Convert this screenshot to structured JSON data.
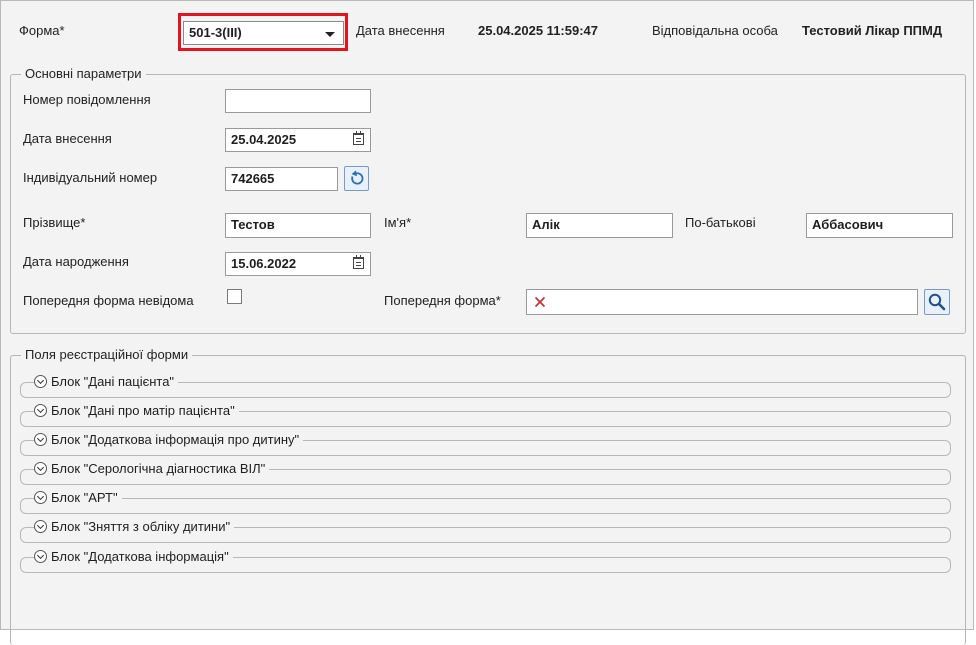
{
  "header": {
    "form_label": "Форма*",
    "form_value": "501-3(III)",
    "entry_date_label": "Дата внесення",
    "entry_date_value": "25.04.2025 11:59:47",
    "responsible_label": "Відповідальна особа",
    "responsible_value": "Тестовий Лікар ППМД"
  },
  "main_params": {
    "legend": "Основні параметри",
    "message_number_label": "Номер повідомлення",
    "message_number_value": "",
    "entry_date_label": "Дата внесення",
    "entry_date_value": "25.04.2025",
    "individual_number_label": "Індивідуальний номер",
    "individual_number_value": "742665",
    "surname_label": "Прізвище*",
    "surname_value": "Тестов",
    "name_label": "Ім'я*",
    "name_value": "Алік",
    "patronymic_label": "По-батькові",
    "patronymic_value": "Аббасович",
    "birth_date_label": "Дата народження",
    "birth_date_value": "15.06.2022",
    "previous_unknown_label": "Попередня форма невідома",
    "previous_unknown_checked": false,
    "previous_form_label": "Попередня форма*",
    "previous_form_value": ""
  },
  "registration": {
    "legend": "Поля реєстраційної форми",
    "blocks": [
      "Блок \"Дані пацієнта\"",
      "Блок \"Дані про матір пацієнта\"",
      "Блок \"Додаткова інформація про дитину\"",
      "Блок \"Серологічна діагностика ВІЛ\"",
      "Блок \"АРТ\"",
      "Блок \"Зняття з обліку дитини\"",
      "Блок \"Додаткова інформація\""
    ]
  },
  "colors": {
    "highlight_border": "#e0151d",
    "clear_icon": "#d0292f",
    "icon_blue": "#2a6fb8"
  },
  "icons": {
    "dropdown": "chevron-down-icon",
    "calendar": "calendar-icon",
    "refresh": "refresh-icon",
    "clear": "close-icon",
    "search": "search-icon",
    "expand": "expand-icon"
  }
}
